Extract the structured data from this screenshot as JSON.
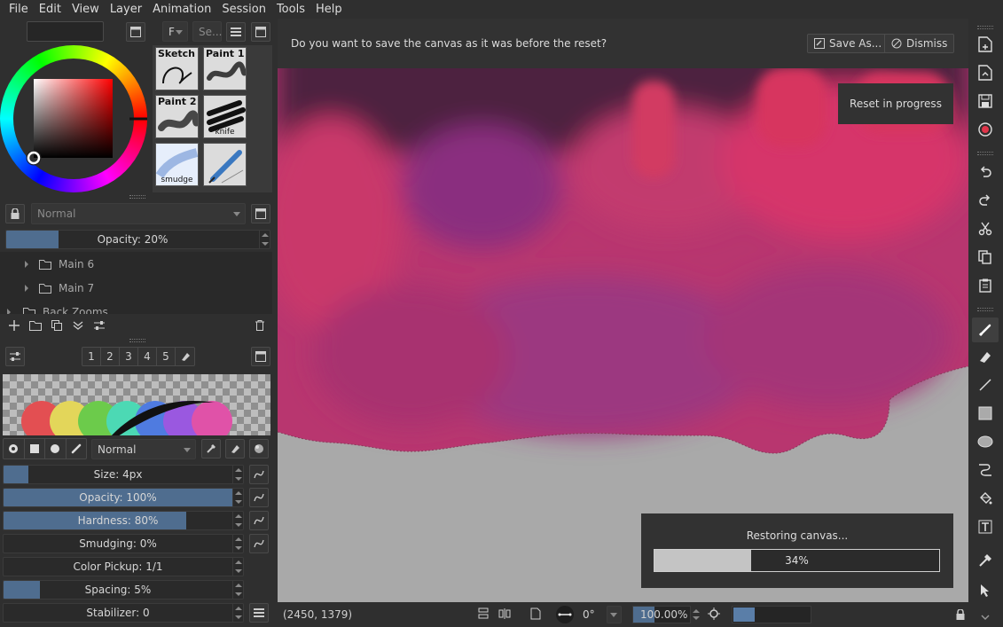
{
  "menu": [
    "File",
    "Edit",
    "View",
    "Layer",
    "Animation",
    "Session",
    "Tools",
    "Help"
  ],
  "brush_presets": {
    "filter_dropdown": "F",
    "search_placeholder": "Se...",
    "presets": [
      {
        "title": "Sketch",
        "sub": ""
      },
      {
        "title": "Paint 1",
        "sub": ""
      },
      {
        "title": "Paint 2",
        "sub": ""
      },
      {
        "title": "",
        "sub": "knife"
      },
      {
        "title": "",
        "sub": "smudge"
      },
      {
        "title": "",
        "sub": ""
      }
    ]
  },
  "layers": {
    "blend_mode": "Normal",
    "opacity_label": "Opacity: 20%",
    "opacity_value": 20,
    "items": [
      "Main 6",
      "Main 7",
      "Back Zooms"
    ]
  },
  "brush_editor": {
    "slots": [
      "1",
      "2",
      "3",
      "4",
      "5"
    ],
    "blend_mode": "Normal",
    "sliders": [
      {
        "label": "Size: 4px",
        "value": 11
      },
      {
        "label": "Opacity: 100%",
        "value": 100
      },
      {
        "label": "Hardness: 80%",
        "value": 80
      },
      {
        "label": "Smudging: 0%",
        "value": 0
      },
      {
        "label": "Color Pickup: 1/1",
        "value": 0
      },
      {
        "label": "Spacing: 5%",
        "value": 16
      },
      {
        "label": "Stabilizer: 0",
        "value": 0
      }
    ]
  },
  "canvas": {
    "prompt": "Do you want to save the canvas as it was before the reset?",
    "save_as_label": "Save As...",
    "dismiss_label": "Dismiss",
    "reset_status": "Reset in progress",
    "restore_label": "Restoring canvas...",
    "restore_progress_label": "34%",
    "restore_progress": 34,
    "colors": {
      "bg": "#a9a9a9",
      "paint_dark": "#4e2440",
      "paint_mid": "#b0356b",
      "paint_hot": "#d6356a"
    }
  },
  "status": {
    "coords": "(2450, 1379)",
    "rotation": "0°",
    "zoom": "100.00%"
  },
  "swatches": [
    "#e34f52",
    "#e3d65a",
    "#6ccb4b",
    "#4cd9b4",
    "#4f7be0",
    "#9a58e0",
    "#e052a8"
  ]
}
